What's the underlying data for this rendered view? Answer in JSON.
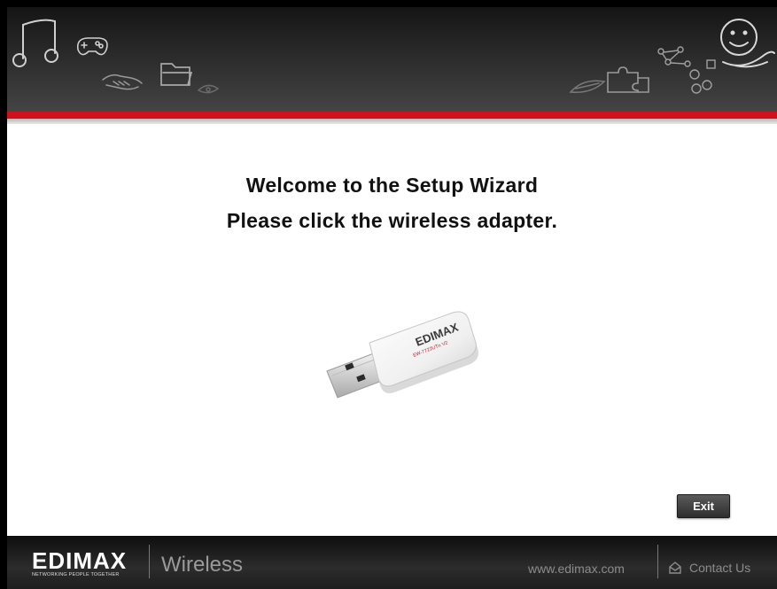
{
  "header": {
    "icons": [
      "music-note-icon",
      "gamepad-icon",
      "handshake-icon",
      "folder-icon",
      "eye-icon",
      "pen-icon",
      "puzzle-icon",
      "network-icon",
      "smiley-icon"
    ]
  },
  "main": {
    "title_line_1": "Welcome to the Setup Wizard",
    "title_line_2": "Please click the wireless adapter.",
    "adapter": {
      "brand": "EDIMAX",
      "model": "EW-7722UTn V2"
    },
    "exit_label": "Exit"
  },
  "footer": {
    "logo_text": "EDIMAX",
    "logo_tagline": "NETWORKING PEOPLE TOGETHER",
    "product": "Wireless",
    "website": "www.edimax.com",
    "contact": "Contact Us"
  },
  "colors": {
    "accent_red": "#d0101a",
    "footer_text": "#8c8c8c"
  }
}
